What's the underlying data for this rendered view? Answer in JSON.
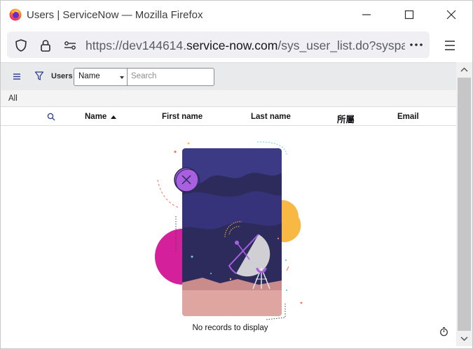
{
  "window": {
    "title": "Users | ServiceNow — Mozilla Firefox"
  },
  "urlbar": {
    "url_prefix": "https://dev144614.",
    "url_domain": "service-now.com",
    "url_suffix": "/sys_user_list.do?sysparm_"
  },
  "toolbar": {
    "label": "Users",
    "field_select": "Name",
    "search_placeholder": "Search"
  },
  "breadcrumb": {
    "label": "All"
  },
  "columns": [
    {
      "label": "Name",
      "sorted": "asc"
    },
    {
      "label": "First name"
    },
    {
      "label": "Last name"
    },
    {
      "label": "所屬"
    },
    {
      "label": "Email"
    }
  ],
  "list": {
    "empty_message": "No records to display"
  },
  "icons": {
    "browser_logo": "firefox-logo-icon",
    "minimize": "minimize-icon",
    "maximize": "maximize-icon",
    "close": "close-icon",
    "shield": "shield-icon",
    "lock": "lock-icon",
    "permissions": "permissions-icon",
    "more": "more-icon",
    "menu": "hamburger-icon",
    "list_menu": "list-menu-icon",
    "filter": "filter-icon",
    "column_search": "search-icon",
    "timer": "stopwatch-icon"
  },
  "colors": {
    "toolbar_bg": "#e9eaec",
    "illustration_navy": "#2d2a5c",
    "illustration_purple": "#a85fe0",
    "illustration_magenta": "#d4209b",
    "illustration_orange": "#f7b944",
    "illustration_ground": "#dfa5a0"
  }
}
